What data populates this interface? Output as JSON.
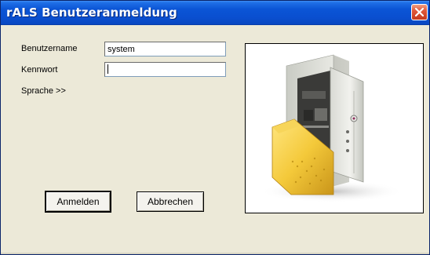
{
  "window": {
    "title": "rALS Benutzeranmeldung",
    "close_icon": "close-icon"
  },
  "form": {
    "username_label": "Benutzername",
    "username_value": "system",
    "password_label": "Kennwort",
    "password_value": "",
    "language_link": "Sprache >>"
  },
  "buttons": {
    "login": "Anmelden",
    "cancel": "Abbrechen"
  },
  "image": {
    "icon": "safe-with-folder-icon"
  },
  "colors": {
    "titlebar": "#0a4fd0",
    "close": "#e0583a",
    "dialog_bg": "#ece9d8"
  }
}
